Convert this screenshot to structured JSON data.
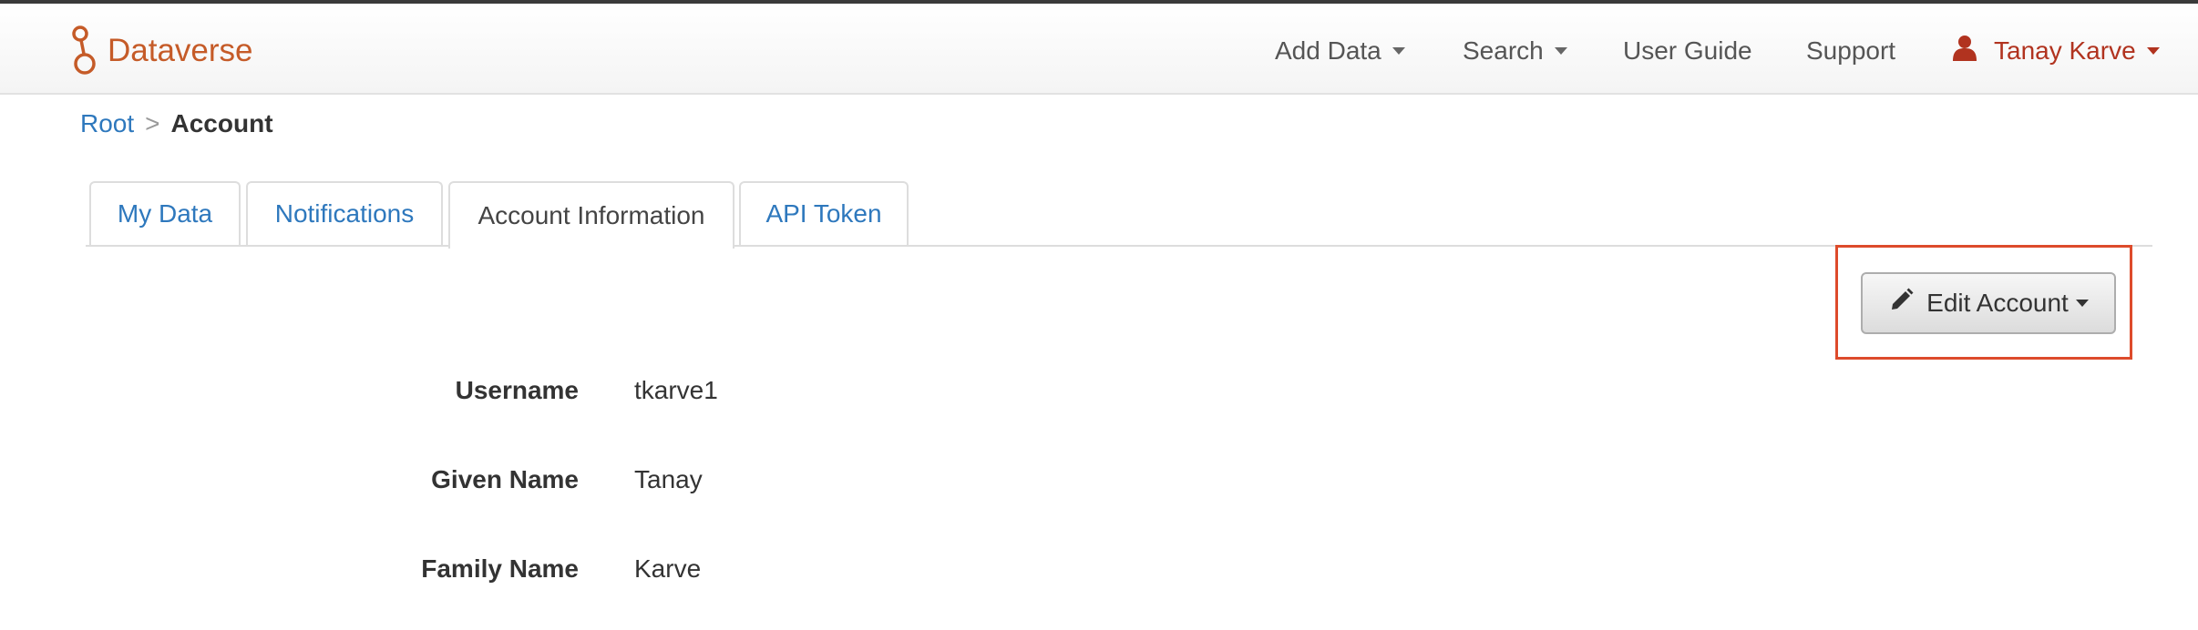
{
  "navbar": {
    "brand": "Dataverse",
    "items": [
      {
        "label": "Add Data",
        "has_caret": true
      },
      {
        "label": "Search",
        "has_caret": true
      },
      {
        "label": "User Guide",
        "has_caret": false
      },
      {
        "label": "Support",
        "has_caret": false
      }
    ],
    "user": {
      "name": "Tanay Karve",
      "icon": "user-icon"
    },
    "brand_color": "#c55b28",
    "user_color": "#b1331f"
  },
  "breadcrumb": {
    "root": "Root",
    "separator": ">",
    "current": "Account"
  },
  "tabs": [
    {
      "label": "My Data",
      "active": false
    },
    {
      "label": "Notifications",
      "active": false
    },
    {
      "label": "Account Information",
      "active": true
    },
    {
      "label": "API Token",
      "active": false
    }
  ],
  "edit_account": {
    "label": "Edit Account",
    "icon": "pencil-icon",
    "highlight_color": "#dd4b2b"
  },
  "account_fields": [
    {
      "label": "Username",
      "value": "tkarve1"
    },
    {
      "label": "Given Name",
      "value": "Tanay"
    },
    {
      "label": "Family Name",
      "value": "Karve"
    }
  ],
  "link_color": "#2e78bd"
}
